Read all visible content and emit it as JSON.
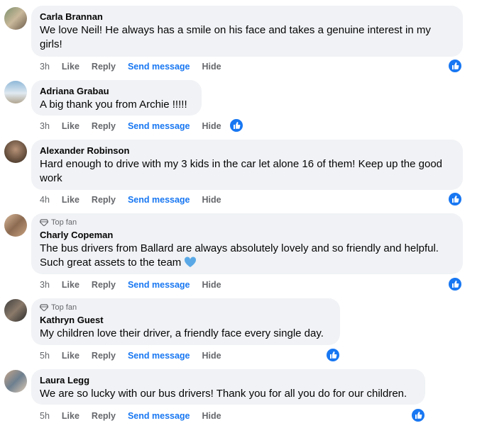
{
  "actions": {
    "like": "Like",
    "reply": "Reply",
    "send_message": "Send message",
    "hide": "Hide"
  },
  "badge": {
    "top_fan": "Top fan"
  },
  "colors": {
    "accent": "#1877f2",
    "bubble": "#f0f2f5",
    "muted": "#65676b"
  },
  "comments": [
    {
      "author": "Carla Brannan",
      "text": "We love Neil! He always has a smile on his face and takes a genuine interest in my girls!",
      "time": "3h"
    },
    {
      "author": "Adriana Grabau",
      "text": "A big thank you from Archie !!!!!",
      "time": "3h"
    },
    {
      "author": "Alexander Robinson",
      "text": "Hard enough to drive with my 3 kids in the car let alone 16 of them! Keep up the good work",
      "time": "4h"
    },
    {
      "author": "Charly Copeman",
      "text": "The bus drivers from Ballard are always absolutely lovely and so friendly and helpful. Such great assets to the team",
      "time": "3h",
      "top_fan": true
    },
    {
      "author": "Kathryn Guest",
      "text": "My children love their driver, a friendly face every single day.",
      "time": "5h",
      "top_fan": true
    },
    {
      "author": "Laura Legg",
      "text": "We are so lucky with our bus drivers! Thank you for all you do for our children.",
      "time": "5h"
    }
  ]
}
